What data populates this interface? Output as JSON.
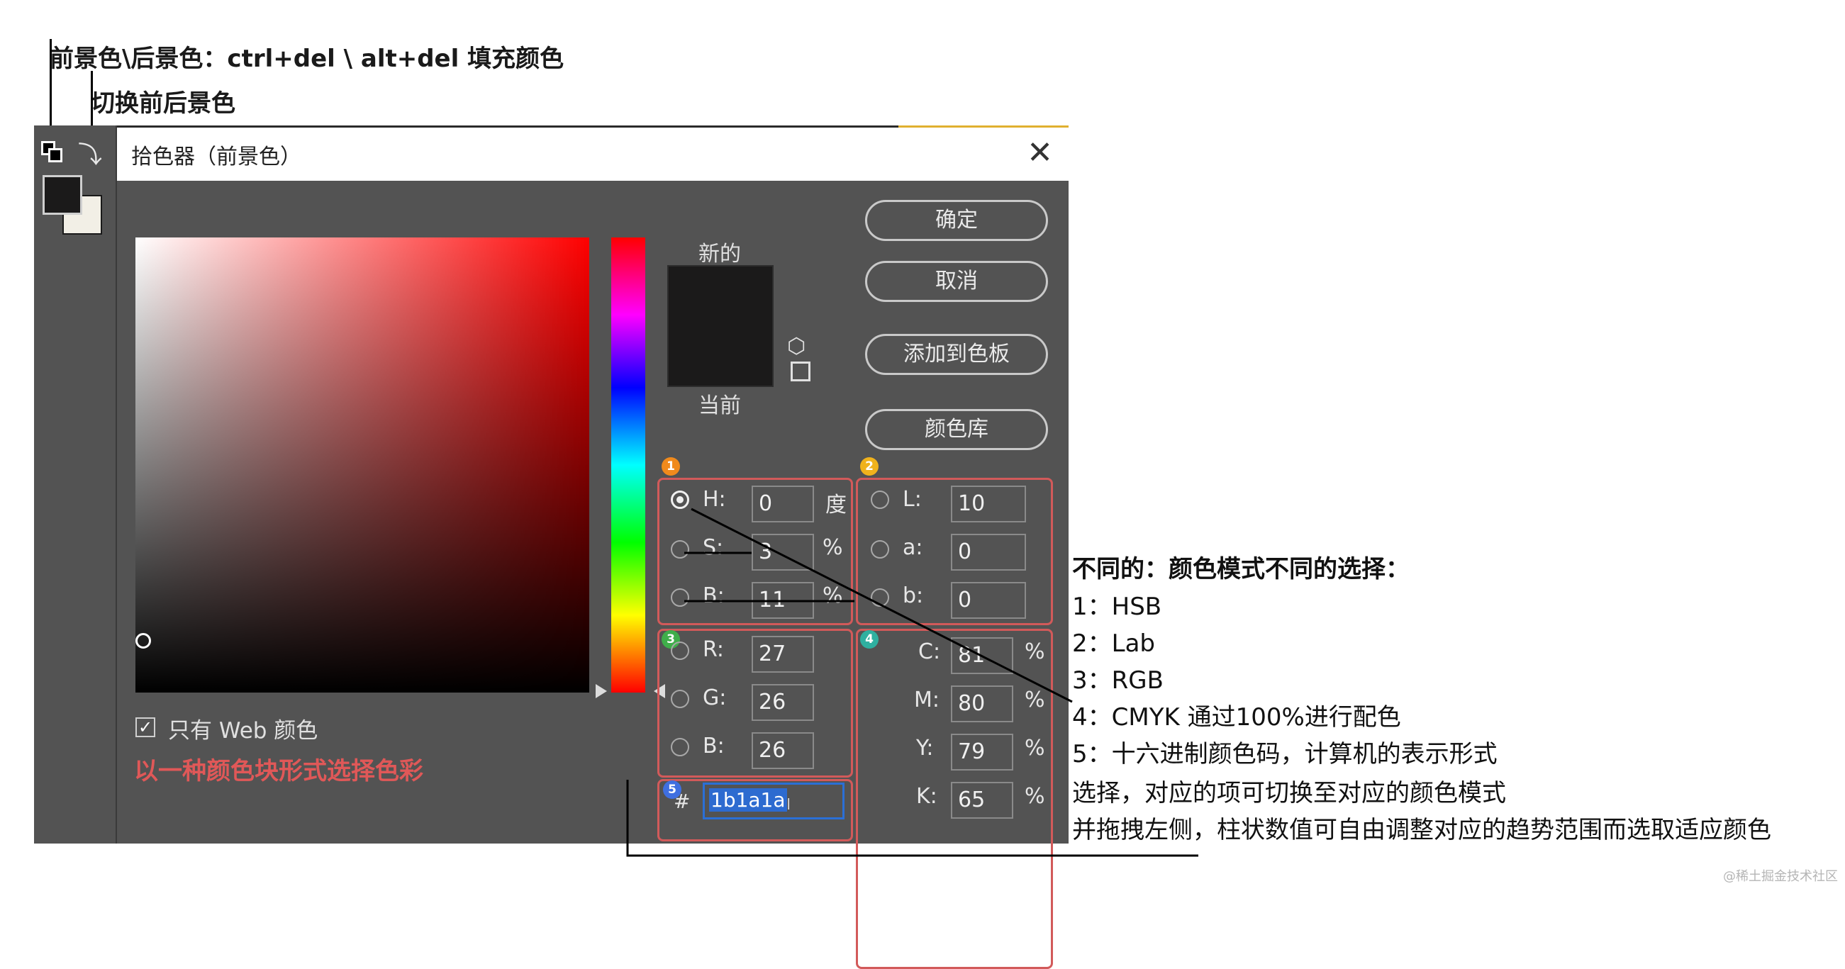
{
  "annotations": {
    "fg_bg_note": "前景色\\后景色：ctrl+del \\ alt+del 填充颜色",
    "swap_note": "切换前后景色",
    "modes_title": "不同的：颜色模式不同的选择：",
    "modes": [
      "1：HSB",
      "2：Lab",
      "3：RGB",
      "4：CMYK 通过100%进行配色",
      "5：十六进制颜色码，计算机的表示形式"
    ],
    "select_note": "选择，对应的项可切换至对应的颜色模式",
    "drag_note": "并拖拽左侧，柱状数值可自由调整对应的趋势范围而选取适应颜色",
    "web_color_note": "以一种颜色块形式选择色彩"
  },
  "dialog": {
    "title": "拾色器（前景色）",
    "new_label": "新的",
    "current_label": "当前",
    "preview_color": "#1b1a1a",
    "buttons": {
      "ok": "确定",
      "cancel": "取消",
      "add_swatch": "添加到色板",
      "color_library": "颜色库"
    },
    "web_only_label": "只有 Web 颜色",
    "web_only_checked": true,
    "hsb": {
      "h_label": "H:",
      "h_value": "0",
      "h_unit": "度",
      "s_label": "S:",
      "s_value": "3",
      "s_unit": "%",
      "b_label": "B:",
      "b_value": "11",
      "b_unit": "%",
      "selected": "H"
    },
    "lab": {
      "l_label": "L:",
      "l_value": "10",
      "a_label": "a:",
      "a_value": "0",
      "b_label": "b:",
      "b_value": "0"
    },
    "rgb": {
      "r_label": "R:",
      "r_value": "27",
      "g_label": "G:",
      "g_value": "26",
      "b_label": "B:",
      "b_value": "26"
    },
    "cmyk": {
      "c_label": "C:",
      "c_value": "81",
      "m_label": "M:",
      "m_value": "80",
      "y_label": "Y:",
      "y_value": "79",
      "k_label": "K:",
      "k_value": "65",
      "unit": "%"
    },
    "hex": {
      "label": "#",
      "value": "1b1a1a"
    }
  },
  "badges": [
    "1",
    "2",
    "3",
    "4",
    "5"
  ],
  "badge_colors": [
    "#f08a1c",
    "#f0b21c",
    "#3fae4a",
    "#2fb0a0",
    "#3f6fe0"
  ],
  "swatches": {
    "foreground": "#1b1a1a",
    "background": "#f2efe6"
  },
  "watermark": "@稀土掘金技术社区"
}
